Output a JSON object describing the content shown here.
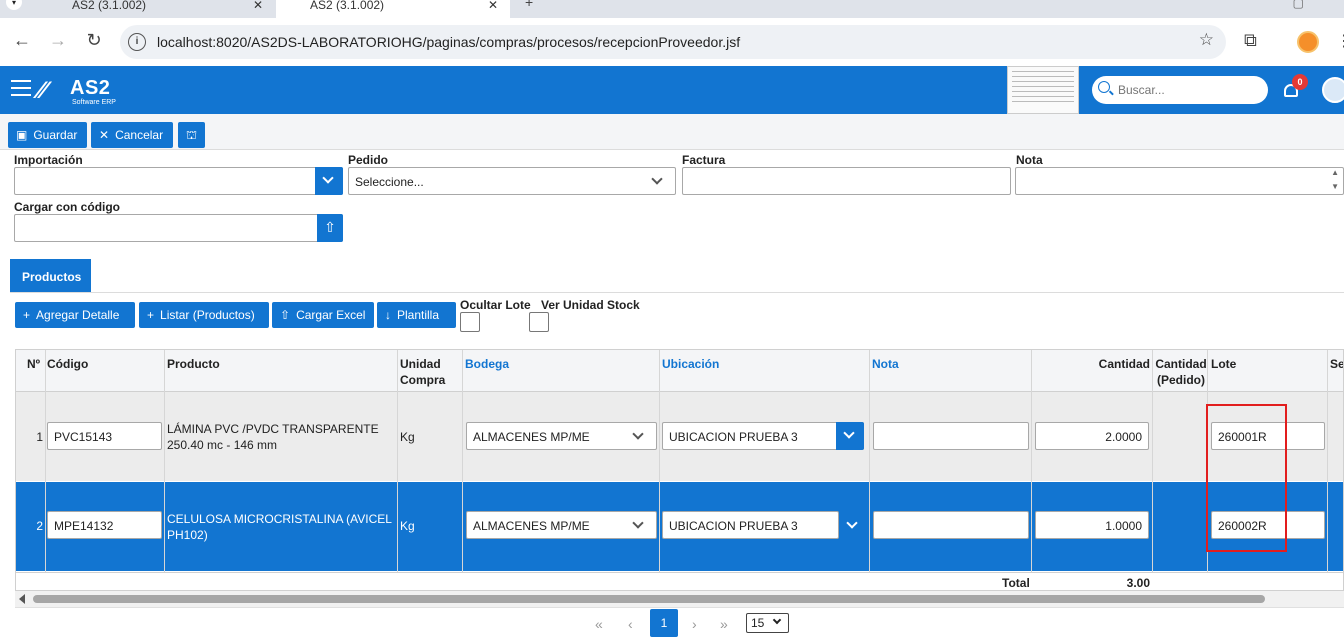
{
  "browser": {
    "tabs": [
      {
        "label": "AS2 (3.1.002)",
        "active": false
      },
      {
        "label": "AS2 (3.1.002)",
        "active": true
      }
    ],
    "url": "localhost:8020/AS2DS-LABORATORIOHG/paginas/compras/procesos/recepcionProveedor.jsf"
  },
  "header": {
    "logo_name": "AS2",
    "logo_sub": "Software ERP",
    "search_placeholder": "Buscar...",
    "notifications": "0",
    "brand_color": "#1275d1"
  },
  "actions": {
    "save": "Guardar",
    "cancel": "Cancelar"
  },
  "form": {
    "importacion": {
      "label": "Importación",
      "value": ""
    },
    "pedido": {
      "label": "Pedido",
      "value": "Seleccione..."
    },
    "factura": {
      "label": "Factura",
      "value": ""
    },
    "nota": {
      "label": "Nota",
      "value": ""
    },
    "cargar_codigo": {
      "label": "Cargar con código",
      "value": ""
    }
  },
  "tabs": {
    "productos": "Productos"
  },
  "detail_buttons": {
    "agregar": "Agregar Detalle",
    "listar": "Listar (Productos)",
    "cargar_excel": "Cargar Excel",
    "plantilla": "Plantilla"
  },
  "options": {
    "ocultar_lote": "Ocultar Lote",
    "ver_unidad": "Ver Unidad Stock"
  },
  "grid": {
    "columns": {
      "num": "Nº",
      "codigo": "Código",
      "producto": "Producto",
      "unidad": "Unidad Compra",
      "bodega": "Bodega",
      "ubicacion": "Ubicación",
      "nota": "Nota",
      "cantidad": "Cantidad",
      "cantidad_pedido": "Cantidad (Pedido)",
      "lote": "Lote",
      "extra": "Se"
    },
    "rows": [
      {
        "num": "1",
        "codigo": "PVC15143",
        "producto": "LÁMINA PVC /PVDC TRANSPARENTE 250.40 mc - 146 mm",
        "unidad": "Kg",
        "bodega": "ALMACENES MP/ME",
        "ubicacion": "UBICACION PRUEBA 3",
        "nota": "",
        "cantidad": "2.0000",
        "lote": "260001R"
      },
      {
        "num": "2",
        "codigo": "MPE14132",
        "producto": "CELULOSA MICROCRISTALINA (AVICEL PH102)",
        "unidad": "Kg",
        "bodega": "ALMACENES MP/ME",
        "ubicacion": "UBICACION PRUEBA 3",
        "nota": "",
        "cantidad": "1.0000",
        "lote": "260002R"
      }
    ],
    "total_label": "Total",
    "total_value": "3.00"
  },
  "pager": {
    "current": "1",
    "page_size": "15"
  }
}
